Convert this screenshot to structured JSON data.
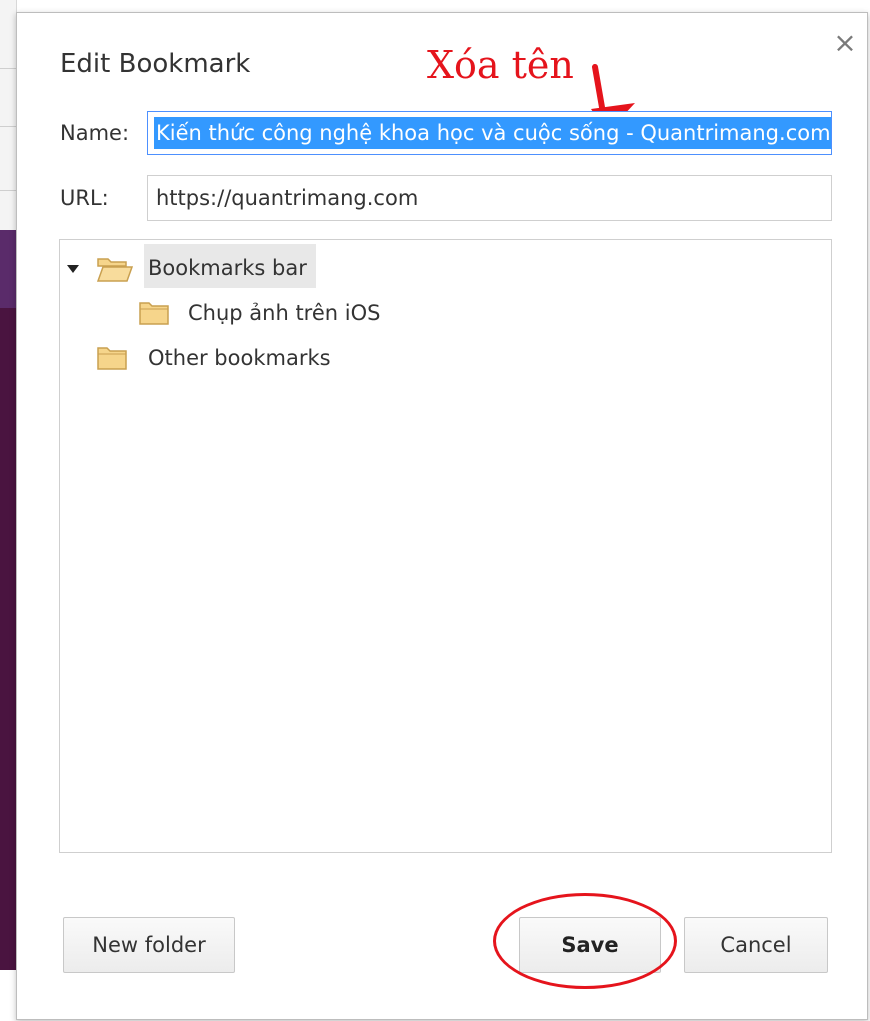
{
  "dialog": {
    "title": "Edit Bookmark",
    "close_symbol": "×",
    "name_label": "Name:",
    "name_value": "Kiến thức công nghệ khoa học và cuộc sống - Quantrimang.com",
    "url_label": "URL:",
    "url_value": "https://quantrimang.com"
  },
  "annotation": {
    "text": "Xóa tên",
    "color": "#e5141c"
  },
  "folders": [
    {
      "label": "Bookmarks bar",
      "expanded": true,
      "selected": true,
      "icon": "folder-open-icon"
    },
    {
      "label": "Chụp ảnh trên iOS",
      "icon": "folder-icon"
    },
    {
      "label": "Other bookmarks",
      "icon": "folder-icon"
    }
  ],
  "buttons": {
    "new_folder": "New folder",
    "save": "Save",
    "cancel": "Cancel"
  },
  "colors": {
    "selection": "#3399ff",
    "focus_border": "#4d90fe",
    "folder_fill": "#f6d58b",
    "folder_stroke": "#c9a050"
  }
}
